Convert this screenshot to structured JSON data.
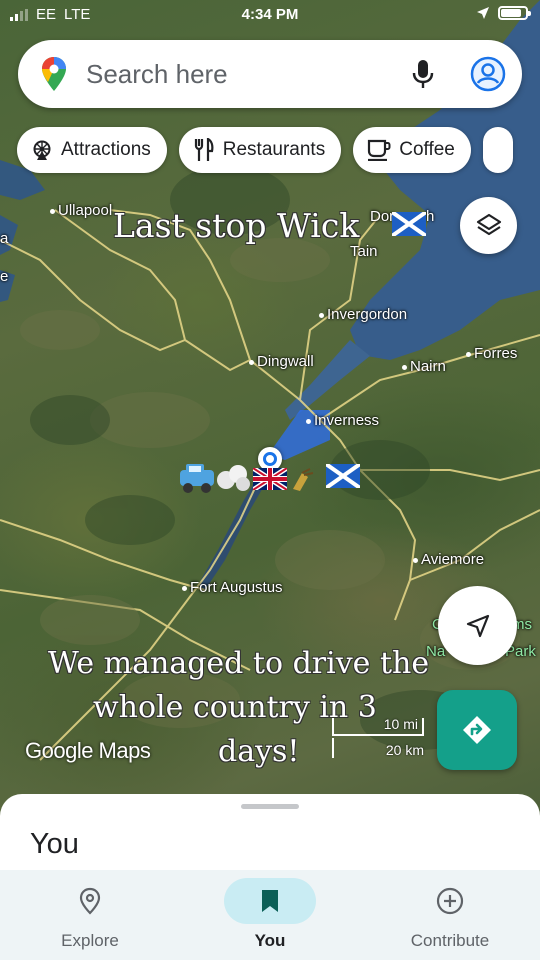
{
  "status_bar": {
    "carrier": "EE",
    "network": "LTE",
    "time": "4:34 PM",
    "battery_level": 0.85
  },
  "search": {
    "placeholder": "Search here"
  },
  "chips": [
    {
      "label": "Attractions",
      "icon": "ferris-wheel-icon"
    },
    {
      "label": "Restaurants",
      "icon": "fork-knife-icon"
    },
    {
      "label": "Coffee",
      "icon": "coffee-cup-icon"
    }
  ],
  "places": {
    "ullapool": "Ullapool",
    "dornoch": "Dor",
    "dornoch_end": "h",
    "tain": "Tain",
    "invergordon": "Invergordon",
    "dingwall": "Dingwall",
    "nairn": "Nairn",
    "forres": "Forres",
    "inverness": "Inverness",
    "aviemore": "Aviemore",
    "fort_augustus": "Fort Augustus",
    "cairngorms_partial": "C",
    "cairngorms_partial_end": "ms",
    "national_park_partial": "Na",
    "national_park_partial_end": "Park",
    "edge_a": "a",
    "edge_e": "e"
  },
  "story": {
    "top": "Last stop Wick",
    "bottom_line1": "We managed to drive the",
    "bottom_line2": "whole country in 3",
    "bottom_line3": "days!"
  },
  "map_overlay": {
    "logo": "Google Maps",
    "scale_imperial": "10 mi",
    "scale_metric": "20 km"
  },
  "sheet": {
    "title": "You"
  },
  "bottom_nav": [
    {
      "label": "Explore",
      "icon": "map-pin-icon",
      "active": false
    },
    {
      "label": "You",
      "icon": "bookmark-icon",
      "active": true
    },
    {
      "label": "Contribute",
      "icon": "add-circle-icon",
      "active": false
    }
  ],
  "colors": {
    "accent": "#14a08a",
    "active_nav": "#c9ecf3",
    "water": "#3a5f8f",
    "location_blue": "#1a73e8"
  }
}
